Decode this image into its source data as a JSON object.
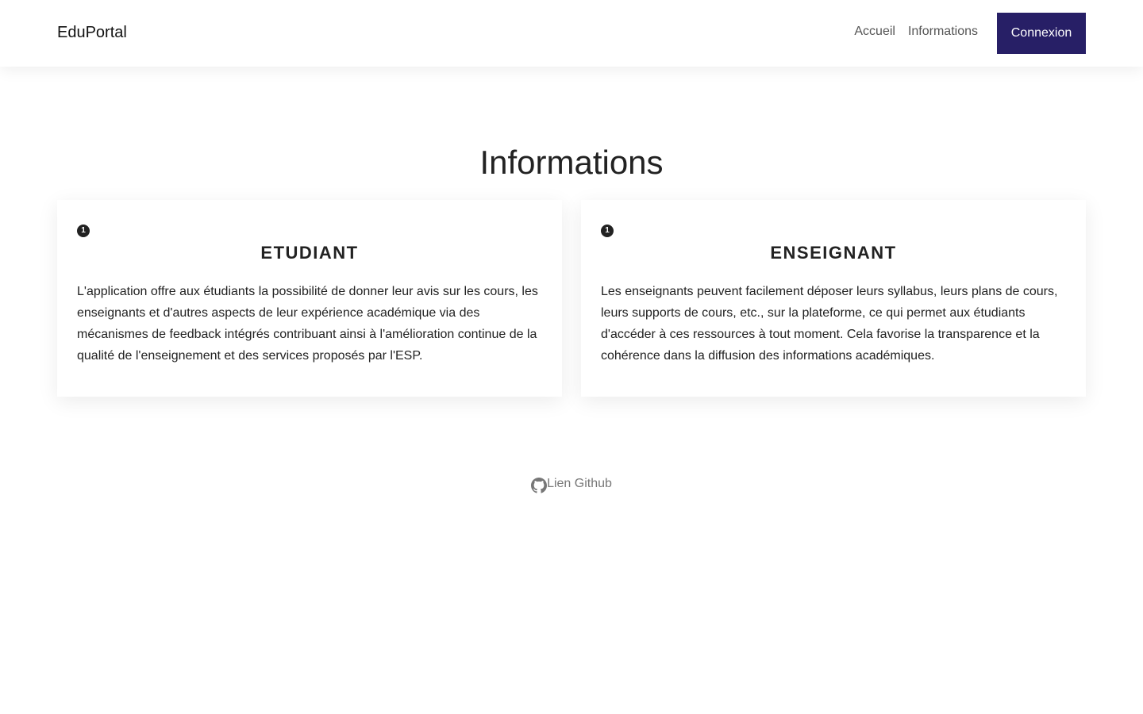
{
  "header": {
    "brand": "EduPortal",
    "nav": [
      {
        "label": "Accueil"
      },
      {
        "label": "Informations"
      }
    ],
    "login_label": "Connexion",
    "accent_color": "#271f66"
  },
  "main": {
    "title": "Informations",
    "cards": [
      {
        "badge": "1",
        "title": "ETUDIANT",
        "text": "L'application offre aux étudiants la possibilité de donner leur avis sur les cours, les enseignants et d'autres aspects de leur expérience académique via des mécanismes de feedback intégrés contribuant ainsi à l'amélioration continue de la qualité de l'enseignement et des services proposés par l'ESP."
      },
      {
        "badge": "1",
        "title": "ENSEIGNANT",
        "text": "Les enseignants peuvent facilement déposer leurs syllabus, leurs plans de cours, leurs supports de cours, etc., sur la plateforme, ce qui permet aux étudiants d'accéder à ces ressources à tout moment. Cela favorise la transparence et la cohérence dans la diffusion des informations académiques."
      }
    ]
  },
  "footer": {
    "icon": "github-icon",
    "link_label": "Lien Github"
  }
}
